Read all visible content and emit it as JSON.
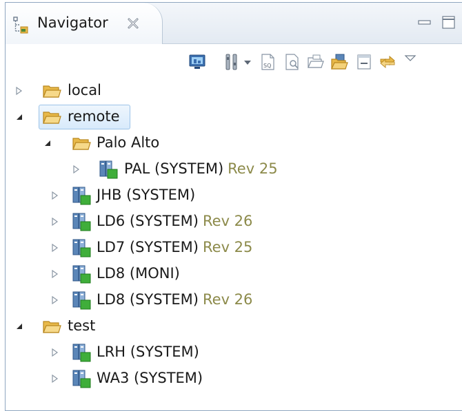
{
  "tab": {
    "title": "Navigator",
    "icon": "navigator-icon",
    "close_icon": "close-icon"
  },
  "window_controls": [
    "minimize-icon",
    "maximize-icon"
  ],
  "toolbar": {
    "buttons": [
      "monitor-icon",
      "tools-icon",
      "dropdown-arrow-icon",
      "sql-file-icon",
      "document-search-icon",
      "open-folder-icon",
      "export-folder-icon",
      "collapse-all-icon",
      "link-with-editor-icon",
      "view-menu-icon"
    ]
  },
  "tree": {
    "nodes": [
      {
        "label": "local",
        "rev": "",
        "type": "folder",
        "expanded": false,
        "depth": 0
      },
      {
        "label": "remote",
        "rev": "",
        "type": "folder",
        "expanded": true,
        "depth": 0,
        "selected": true
      },
      {
        "label": "Palo Alto",
        "rev": "",
        "type": "folder",
        "expanded": true,
        "depth": 1
      },
      {
        "label": "PAL (SYSTEM)",
        "rev": "Rev 25",
        "type": "system",
        "expanded": false,
        "depth": 2
      },
      {
        "label": "JHB (SYSTEM)",
        "rev": "",
        "type": "system",
        "expanded": false,
        "depth": 1
      },
      {
        "label": "LD6 (SYSTEM)",
        "rev": "Rev 26",
        "type": "system",
        "expanded": false,
        "depth": 1
      },
      {
        "label": "LD7 (SYSTEM)",
        "rev": "Rev 25",
        "type": "system",
        "expanded": false,
        "depth": 1
      },
      {
        "label": "LD8 (MONI)",
        "rev": "",
        "type": "system",
        "expanded": false,
        "depth": 1
      },
      {
        "label": "LD8 (SYSTEM)",
        "rev": "Rev 26",
        "type": "system",
        "expanded": false,
        "depth": 1
      },
      {
        "label": "test",
        "rev": "",
        "type": "folder",
        "expanded": true,
        "depth": 0
      },
      {
        "label": "LRH (SYSTEM)",
        "rev": "",
        "type": "system",
        "expanded": false,
        "depth": 1
      },
      {
        "label": "WA3 (SYSTEM)",
        "rev": "",
        "type": "system",
        "expanded": false,
        "depth": 1
      }
    ]
  },
  "colors": {
    "revision_text": "#8c8a4a",
    "folder": "#e8b94a",
    "system_icon_blue": "#5b86b8",
    "system_icon_green": "#3fae3a",
    "selection": "#d8eafb"
  }
}
